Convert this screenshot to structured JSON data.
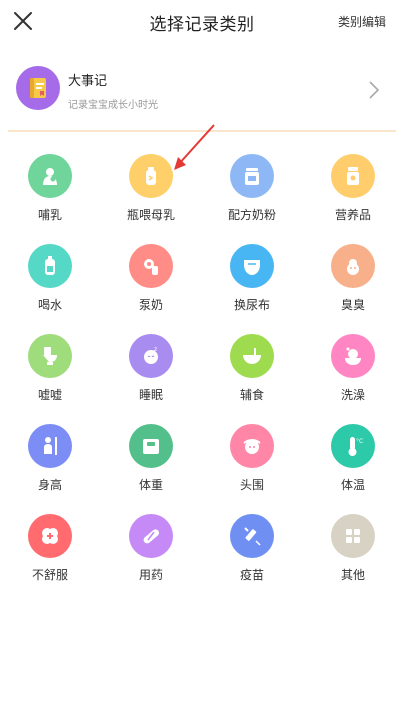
{
  "header": {
    "title": "选择记录类别",
    "edit_label": "类别编辑",
    "close_icon": "close-icon"
  },
  "event_card": {
    "title": "大事记",
    "subtitle": "记录宝宝成长小时光",
    "icon": "notebook-icon",
    "icon_color": "#a66be8"
  },
  "categories": [
    {
      "label": "哺乳",
      "icon": "breastfeeding-icon",
      "color": "#6fd59a"
    },
    {
      "label": "瓶喂母乳",
      "icon": "baby-bottle-icon",
      "color": "#ffcf6a"
    },
    {
      "label": "配方奶粉",
      "icon": "formula-milk-icon",
      "color": "#8eb8f5"
    },
    {
      "label": "营养品",
      "icon": "supplement-jar-icon",
      "color": "#ffcd6b"
    },
    {
      "label": "喝水",
      "icon": "water-bottle-icon",
      "color": "#56d8c6"
    },
    {
      "label": "泵奶",
      "icon": "breast-pump-icon",
      "color": "#ff8c86"
    },
    {
      "label": "换尿布",
      "icon": "diaper-icon",
      "color": "#48b6f2"
    },
    {
      "label": "臭臭",
      "icon": "poop-icon",
      "color": "#f7b08a"
    },
    {
      "label": "嘘嘘",
      "icon": "toilet-icon",
      "color": "#9fdc7c"
    },
    {
      "label": "睡眠",
      "icon": "sleeping-baby-icon",
      "color": "#a98cf0"
    },
    {
      "label": "辅食",
      "icon": "food-bowl-icon",
      "color": "#9fdb4f"
    },
    {
      "label": "洗澡",
      "icon": "bath-icon",
      "color": "#ff86c2"
    },
    {
      "label": "身高",
      "icon": "height-measure-icon",
      "color": "#7c8ef5"
    },
    {
      "label": "体重",
      "icon": "weight-scale-icon",
      "color": "#53c08b"
    },
    {
      "label": "头围",
      "icon": "head-circumference-icon",
      "color": "#ff86a6"
    },
    {
      "label": "体温",
      "icon": "thermometer-icon",
      "color": "#2ccaa8"
    },
    {
      "label": "不舒服",
      "icon": "first-aid-icon",
      "color": "#ff6b6e"
    },
    {
      "label": "用药",
      "icon": "pill-icon",
      "color": "#c58af5"
    },
    {
      "label": "疫苗",
      "icon": "syringe-icon",
      "color": "#6f8ff2"
    },
    {
      "label": "其他",
      "icon": "other-grid-icon",
      "color": "#d8d2c4"
    }
  ],
  "annotation": {
    "arrow_color": "#e53935"
  }
}
